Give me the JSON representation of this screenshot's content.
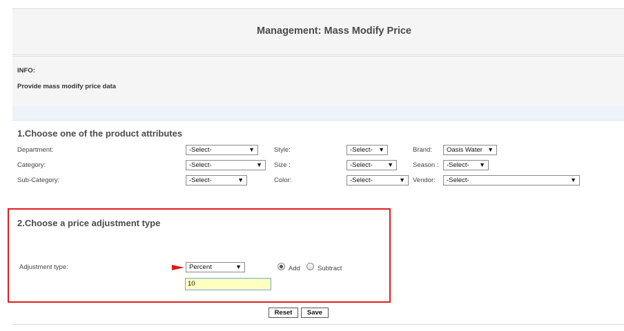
{
  "header": {
    "title": "Management: Mass Modify Price"
  },
  "info": {
    "label": "INFO:",
    "text": "Provide mass modify price data"
  },
  "section1": {
    "title": "1.Choose one of the product attributes",
    "department": {
      "label": "Department:",
      "value": "-Select-"
    },
    "category": {
      "label": "Category:",
      "value": "-Select-"
    },
    "subcategory": {
      "label": "Sub-Category:",
      "value": "-Select-"
    },
    "style": {
      "label": "Style:",
      "value": "-Select-"
    },
    "size": {
      "label": "Size :",
      "value": "-Select-"
    },
    "color": {
      "label": "Color:",
      "value": "-Select-"
    },
    "brand": {
      "label": "Brand:",
      "value": "Oasis Water"
    },
    "season": {
      "label": "Season :",
      "value": "-Select-"
    },
    "vendor": {
      "label": "Vendor:",
      "value": "-Select-"
    }
  },
  "section2": {
    "title": "2.Choose a price adjustment type",
    "adjustment_label": "Adjustment type:",
    "adjustment_value": "Percent",
    "radio_add": "Add",
    "radio_subtract": "Subtract",
    "selected_radio": "Add",
    "amount": "10"
  },
  "buttons": {
    "reset": "Reset",
    "save": "Save"
  },
  "colors": {
    "highlight_border": "#e01b1b",
    "pointer_arrow": "#e01b1b",
    "input_bg": "#ffffc0"
  },
  "icons": {
    "dropdown": "triangle-down",
    "pointer": "red-arrow-right"
  }
}
